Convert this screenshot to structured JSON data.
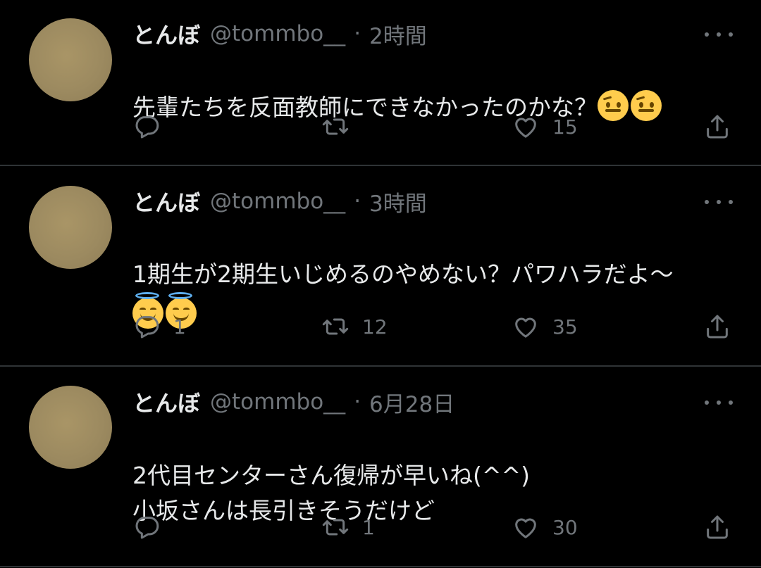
{
  "colors": {
    "background": "#000000",
    "text": "#e7e9ea",
    "secondary": "#71767b",
    "divider": "#2f3336"
  },
  "icons": {
    "reply": "reply-icon",
    "retweet": "retweet-icon",
    "like": "heart-icon",
    "share": "share-icon",
    "more": "more-icon"
  },
  "tweets": [
    {
      "name": "とんぼ",
      "handle": "@tommbo__",
      "dot": "·",
      "time": "2時間",
      "text": "先輩たちを反面教師にできなかったのかな？",
      "emojis": [
        "face-with-raised-eyebrow",
        "face-with-raised-eyebrow"
      ],
      "reply_count": "",
      "retweet_count": "",
      "like_count": "15"
    },
    {
      "name": "とんぼ",
      "handle": "@tommbo__",
      "dot": "·",
      "time": "3時間",
      "text": "1期生が2期生いじめるのやめない？パワハラだよ〜",
      "emojis": [
        "smiling-face-with-halo",
        "smiling-face-with-halo"
      ],
      "reply_count": "1",
      "retweet_count": "12",
      "like_count": "35"
    },
    {
      "name": "とんぼ",
      "handle": "@tommbo__",
      "dot": "·",
      "time": "6月28日",
      "text": "2代目センターさん復帰が早いね(^^)\n小坂さんは長引きそうだけど",
      "emojis": [],
      "reply_count": "",
      "retweet_count": "1",
      "like_count": "30"
    }
  ]
}
